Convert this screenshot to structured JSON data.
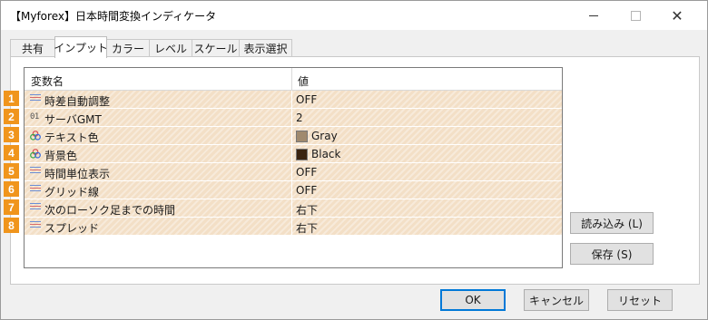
{
  "window": {
    "title": "【Myforex】日本時間変換インディケータ"
  },
  "tabs": [
    {
      "label": "共有",
      "active": false
    },
    {
      "label": "インプット",
      "active": true
    },
    {
      "label": "カラー",
      "active": false
    },
    {
      "label": "レベル",
      "active": false
    },
    {
      "label": "スケール",
      "active": false
    },
    {
      "label": "表示選択",
      "active": false
    }
  ],
  "grid": {
    "headers": {
      "name": "変数名",
      "value": "値"
    },
    "rows": [
      {
        "badge": "1",
        "icon": "lines-icon",
        "name": "時差自動調整",
        "value": "OFF"
      },
      {
        "badge": "2",
        "icon": "number-icon",
        "icon_text": "01",
        "name": "サーバGMT",
        "value": "2"
      },
      {
        "badge": "3",
        "icon": "color-palette-icon",
        "name": "テキスト色",
        "value": "Gray",
        "swatch": "#a08a6e"
      },
      {
        "badge": "4",
        "icon": "color-palette-icon",
        "name": "背景色",
        "value": "Black",
        "swatch": "#3a2410"
      },
      {
        "badge": "5",
        "icon": "lines-icon",
        "name": "時間単位表示",
        "value": "OFF"
      },
      {
        "badge": "6",
        "icon": "lines-icon",
        "name": "グリッド線",
        "value": "OFF"
      },
      {
        "badge": "7",
        "icon": "lines-icon",
        "name": "次のローソク足までの時間",
        "value": "右下"
      },
      {
        "badge": "8",
        "icon": "lines-icon",
        "name": "スプレッド",
        "value": "右下"
      }
    ]
  },
  "buttons": {
    "load": "読み込み (L)",
    "save": "保存 (S)",
    "ok": "OK",
    "cancel": "キャンセル",
    "reset": "リセット"
  },
  "colors": {
    "row_bg": "#f3dfc6",
    "badge": "#f0951c",
    "ok_border": "#0078d7"
  }
}
